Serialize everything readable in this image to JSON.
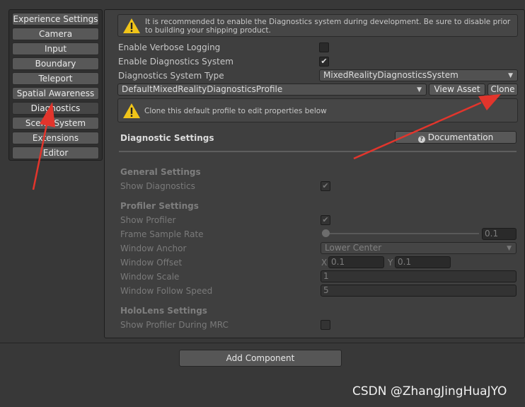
{
  "nav": {
    "items": [
      {
        "label": "Experience Settings"
      },
      {
        "label": "Camera"
      },
      {
        "label": "Input"
      },
      {
        "label": "Boundary"
      },
      {
        "label": "Teleport"
      },
      {
        "label": "Spatial Awareness"
      },
      {
        "label": "Diagnostics"
      },
      {
        "label": "Scene System"
      },
      {
        "label": "Extensions"
      },
      {
        "label": "Editor"
      }
    ],
    "active": "Diagnostics"
  },
  "panel": {
    "warning_text": "It is recommended to enable the Diagnostics system during development. Be sure to disable prior to building your shipping product.",
    "verbose_label": "Enable Verbose Logging",
    "enable_label": "Enable Diagnostics System",
    "type_label": "Diagnostics System Type",
    "type_value": "MixedRealityDiagnosticsSystem",
    "profile_value": "DefaultMixedRealityDiagnosticsProfile",
    "view_asset": "View Asset",
    "clone": "Clone",
    "clone_note": "Clone this default profile to edit properties below",
    "section_title": "Diagnostic Settings",
    "documentation": "Documentation",
    "general_header": "General Settings",
    "show_diagnostics": "Show Diagnostics",
    "profiler_header": "Profiler Settings",
    "show_profiler": "Show Profiler",
    "frame_rate_label": "Frame Sample Rate",
    "frame_rate_value": "0.1",
    "window_anchor_label": "Window Anchor",
    "window_anchor_value": "Lower Center",
    "window_offset_label": "Window Offset",
    "offset_x_label": "X",
    "offset_x_value": "0.1",
    "offset_y_label": "Y",
    "offset_y_value": "0.1",
    "window_scale_label": "Window Scale",
    "window_scale_value": "1",
    "follow_speed_label": "Window Follow Speed",
    "follow_speed_value": "5",
    "holo_header": "HoloLens Settings",
    "mrc_label": "Show Profiler During MRC"
  },
  "add_component": "Add Component",
  "watermark": "CSDN @ZhangJingHuaJYO",
  "colors": {
    "arrow": "#e2352c",
    "warning": "#f0c419"
  }
}
